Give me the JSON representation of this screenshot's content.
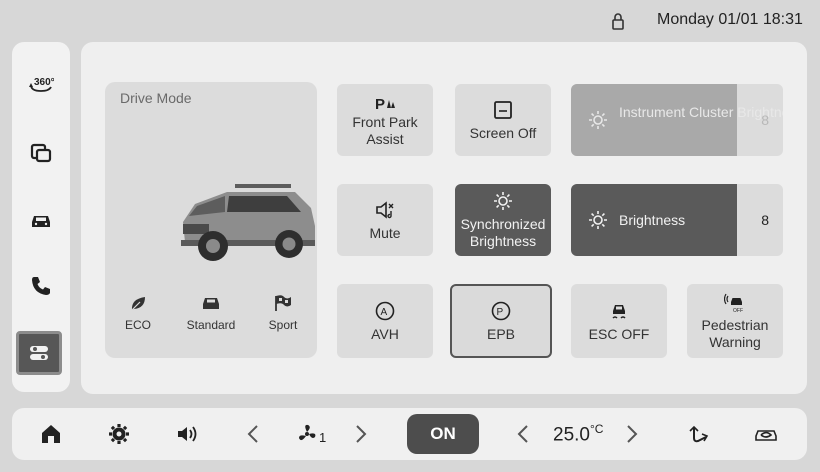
{
  "status": {
    "datetime": "Monday 01/01 18:31"
  },
  "sidebar": {
    "items": [
      {
        "icon": "360-view-icon",
        "label": "360°"
      },
      {
        "icon": "windows-icon"
      },
      {
        "icon": "car-icon"
      },
      {
        "icon": "phone-icon"
      },
      {
        "icon": "settings-toggle-icon",
        "active": true
      }
    ]
  },
  "drive_mode": {
    "title": "Drive Mode",
    "modes": [
      "ECO",
      "Standard",
      "Sport"
    ]
  },
  "tiles": {
    "front_park_assist": "Front Park Assist",
    "screen_off": "Screen Off",
    "mute": "Mute",
    "sync_brightness": "Synchronized Brightness",
    "avh": "AVH",
    "epb": "EPB",
    "esc_off": "ESC OFF",
    "pedestrian_warning": "Pedestrian Warning"
  },
  "sliders": {
    "instrument": {
      "label": "Instrument Cluster Brightness",
      "value": "8",
      "level": 0.8
    },
    "brightness": {
      "label": "Brightness",
      "value": "8",
      "level": 0.8
    }
  },
  "climate": {
    "fan_level": "1",
    "ac_label": "ON",
    "temperature": "25.0",
    "unit": "°C"
  },
  "colors": {
    "active_dark": "#5a5a5a",
    "tile": "#dcdcdc",
    "panel": "#efefef"
  }
}
